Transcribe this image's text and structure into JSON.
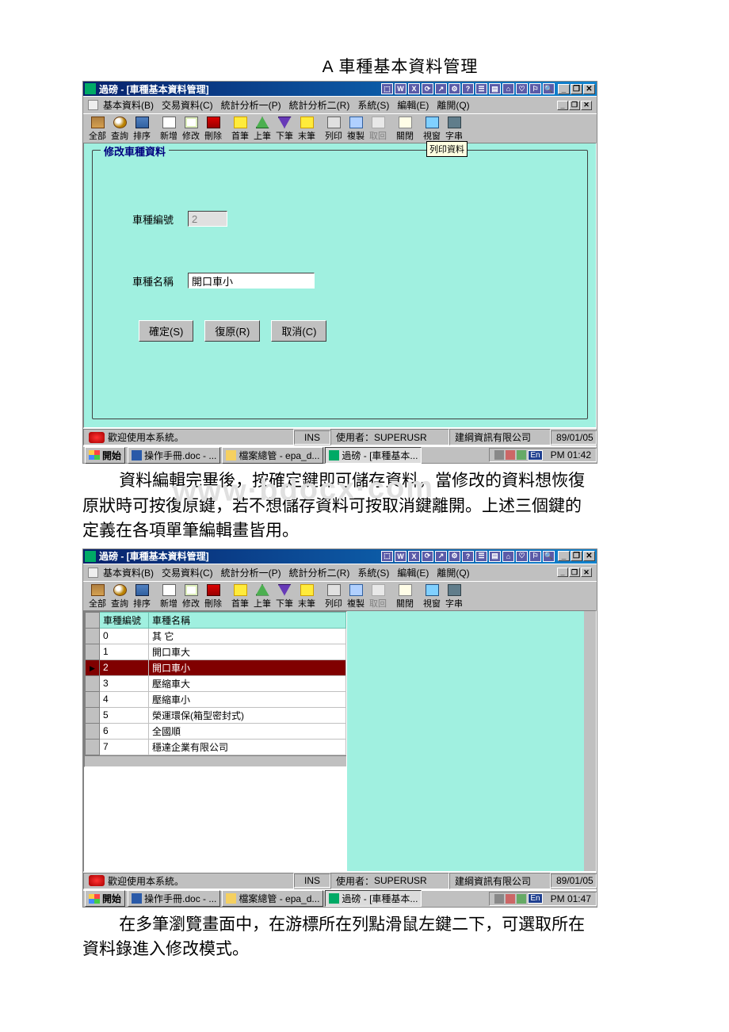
{
  "doc_title": "A 車種基本資料管理",
  "app1": {
    "title": "過磅 - [車種基本資料管理]",
    "tooltip": "列印資料",
    "mdi_controls": [
      "_",
      "❐",
      "✕"
    ],
    "window_controls": [
      "_",
      "❐",
      "✕"
    ],
    "group_legend": "修改車種資料",
    "fields": {
      "id_label": "車種編號",
      "id_value": "2",
      "name_label": "車種名稱",
      "name_value": "開口車小"
    },
    "buttons": {
      "ok": "確定(S)",
      "restore": "復原(R)",
      "cancel": "取消(C)"
    }
  },
  "app2": {
    "title": "過磅 - [車種基本資料管理]",
    "grid": {
      "headers": [
        "車種編號",
        "車種名稱"
      ],
      "rows": [
        {
          "id": "0",
          "name": "其    它"
        },
        {
          "id": "1",
          "name": "開口車大"
        },
        {
          "id": "2",
          "name": "開口車小",
          "selected": true
        },
        {
          "id": "3",
          "name": "壓縮車大"
        },
        {
          "id": "4",
          "name": "壓縮車小"
        },
        {
          "id": "5",
          "name": "榮運環保(箱型密封式)"
        },
        {
          "id": "6",
          "name": "全國順"
        },
        {
          "id": "7",
          "name": "穩達企業有限公司"
        }
      ]
    }
  },
  "menu": [
    "基本資料(B)",
    "交易資料(C)",
    "統計分析一(P)",
    "統計分析二(R)",
    "系統(S)",
    "編輯(E)",
    "離開(Q)"
  ],
  "toolbar": [
    {
      "k": "all",
      "t": "全部",
      "i": "ico-book"
    },
    {
      "k": "query",
      "t": "查詢",
      "i": "ico-find"
    },
    {
      "k": "sort",
      "t": "排序",
      "i": "ico-sort"
    },
    {
      "sep": true
    },
    {
      "k": "add",
      "t": "新增",
      "i": "ico-new"
    },
    {
      "k": "mod",
      "t": "修改",
      "i": "ico-edit"
    },
    {
      "k": "del",
      "t": "刪除",
      "i": "ico-del"
    },
    {
      "sep": true
    },
    {
      "k": "first",
      "t": "首筆",
      "i": "ico-first"
    },
    {
      "k": "prev",
      "t": "上筆",
      "i": "ico-prev"
    },
    {
      "k": "next",
      "t": "下筆",
      "i": "ico-next"
    },
    {
      "k": "last",
      "t": "末筆",
      "i": "ico-last"
    },
    {
      "sep": true
    },
    {
      "k": "print",
      "t": "列印",
      "i": "ico-print"
    },
    {
      "k": "copy",
      "t": "複製",
      "i": "ico-copy"
    },
    {
      "k": "undo",
      "t": "取回",
      "i": "ico-undo",
      "disabled": true
    },
    {
      "sep": true
    },
    {
      "k": "closef",
      "t": "關閉",
      "i": "ico-close"
    },
    {
      "sep": true
    },
    {
      "k": "view",
      "t": "視窗",
      "i": "ico-view"
    },
    {
      "k": "font",
      "t": "字串",
      "i": "ico-font"
    }
  ],
  "status": {
    "welcome": "歡迎使用本系統。",
    "ins": "INS",
    "user_label": "使用者：",
    "user": "SUPERUSR",
    "company": "建綱資訊有限公司",
    "date": "89/01/05"
  },
  "taskbar1": {
    "start": "開始",
    "tasks": [
      {
        "t": "操作手冊.doc - ...",
        "i": "ti-word"
      },
      {
        "t": "檔案總管 - epa_d...",
        "i": "ti-folder"
      },
      {
        "t": "過磅 - [車種基本...",
        "i": "ti-app",
        "active": true
      }
    ],
    "lang": "En",
    "time": "PM 01:42"
  },
  "taskbar2": {
    "start": "開始",
    "tasks": [
      {
        "t": "操作手冊.doc - ...",
        "i": "ti-word"
      },
      {
        "t": "檔案總管 - epa_d...",
        "i": "ti-folder"
      },
      {
        "t": "過磅 - [車種基本...",
        "i": "ti-app",
        "active": true
      }
    ],
    "lang": "En",
    "time": "PM 01:47"
  },
  "body1": "資料編輯完畢後，按確定鍵即可儲存資料，當修改的資料想恢復原狀時可按復原鍵，若不想儲存資料可按取消鍵離開。上述三個鍵的定義在各項單筆編輯畫皆用。",
  "body2": "在多筆瀏覽畫面中，在游標所在列點滑鼠左鍵二下，可選取所在資料錄進入修改模式。",
  "watermark": "www·bdocx·com"
}
